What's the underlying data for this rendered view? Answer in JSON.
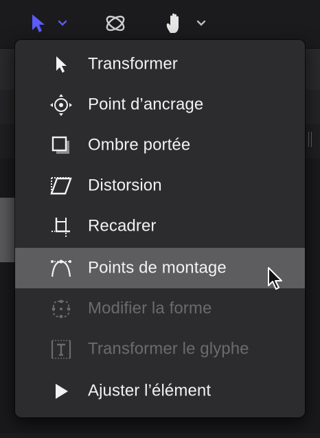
{
  "toolbar": {
    "tools": [
      {
        "icon": "arrow-pointer-icon",
        "color": "#5b5bff"
      },
      {
        "icon": "orbit-3d-icon"
      },
      {
        "icon": "hand-pan-icon"
      }
    ]
  },
  "menu": {
    "items": [
      {
        "label": "Transformer",
        "icon": "arrow-pointer-icon",
        "state": "normal"
      },
      {
        "label": "Point d’ancrage",
        "icon": "anchor-point-icon",
        "state": "normal"
      },
      {
        "label": "Ombre portée",
        "icon": "drop-shadow-icon",
        "state": "normal"
      },
      {
        "label": "Distorsion",
        "icon": "distort-icon",
        "state": "normal"
      },
      {
        "label": "Recadrer",
        "icon": "crop-icon",
        "state": "normal"
      },
      {
        "label": "Points de montage",
        "icon": "edit-points-icon",
        "state": "selected"
      },
      {
        "label": "Modifier la forme",
        "icon": "modify-shape-icon",
        "state": "disabled"
      },
      {
        "label": "Transformer le glyphe",
        "icon": "transform-glyph-icon",
        "state": "disabled"
      },
      {
        "label": "Ajuster l’élément",
        "icon": "adjust-item-icon",
        "state": "normal"
      }
    ]
  },
  "colors": {
    "accent": "#5b5bff",
    "menu_bg": "#2c2c2e",
    "selected_bg": "#5d5d60",
    "text": "#f2f2f2",
    "disabled_text": "#6b6b6e"
  }
}
